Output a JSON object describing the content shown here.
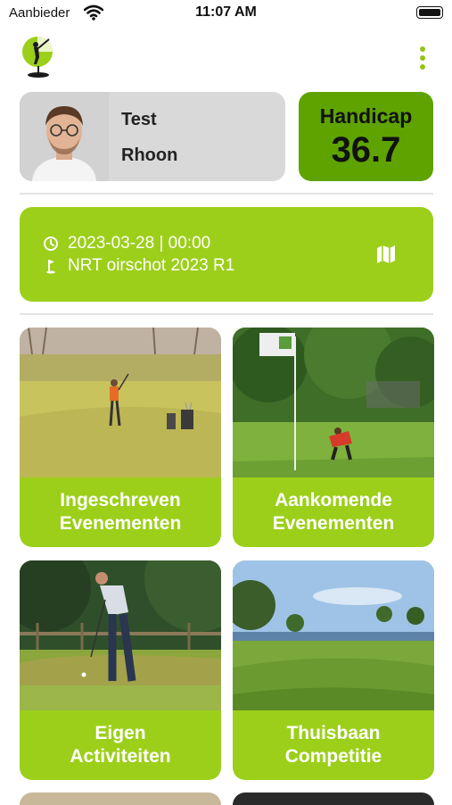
{
  "status_bar": {
    "carrier": "Aanbieder",
    "time": "11:07 AM"
  },
  "header": {
    "logo_icon": "golf-logo-icon",
    "menu_icon": "kebab-menu-icon"
  },
  "profile": {
    "first_name": "Test",
    "last_name": "Rhoon",
    "avatar_icon": "person-avatar"
  },
  "handicap": {
    "label": "Handicap",
    "value": "36.7"
  },
  "next_event": {
    "datetime": "2023-03-28 | 00:00",
    "course": "NRT oirschot 2023 R1",
    "clock_icon": "clock-icon",
    "flag_icon": "golf-flag-icon",
    "map_icon": "map-icon"
  },
  "tiles": [
    {
      "line1": "Ingeschreven",
      "line2": "Evenementen"
    },
    {
      "line1": "Aankomende",
      "line2": "Evenementen"
    },
    {
      "line1": "Eigen",
      "line2": "Activiteiten"
    },
    {
      "line1": "Thuisbaan",
      "line2": "Competitie"
    }
  ],
  "colors": {
    "accent": "#9ccf1a",
    "handicap_bg": "#5ea300",
    "profile_bg": "#d9d9d9",
    "menu_dots": "#93c41a"
  }
}
